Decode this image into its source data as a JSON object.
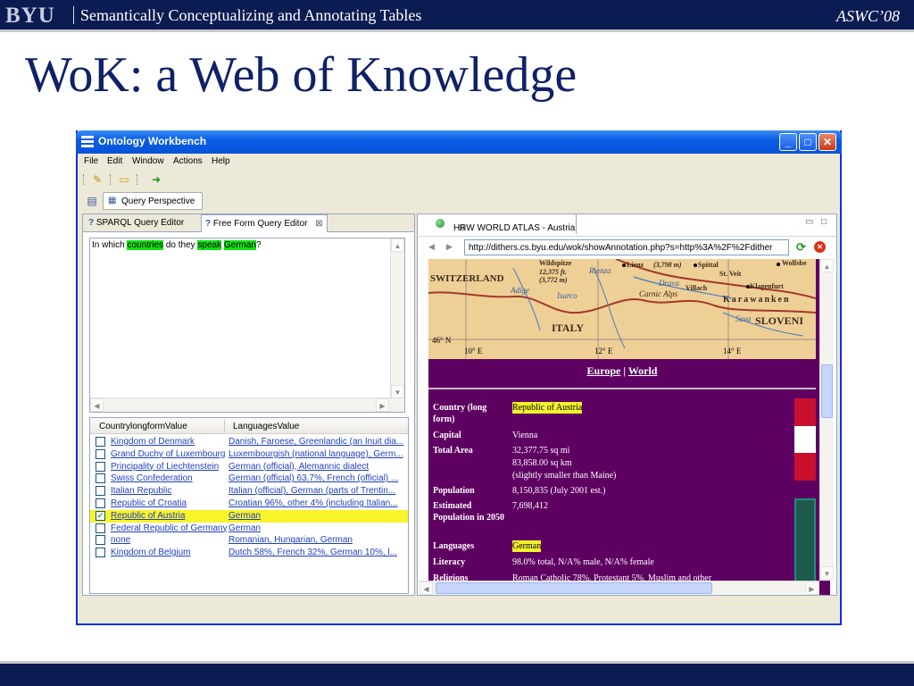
{
  "slide": {
    "logo": "BYU",
    "subtitle": "Semantically Conceptualizing and Annotating Tables",
    "conference": "ASWC’08",
    "title": "WoK: a Web of Knowledge"
  },
  "window": {
    "title": "Ontology Workbench",
    "menus": [
      "File",
      "Edit",
      "Window",
      "Actions",
      "Help"
    ],
    "perspective": "Query Perspective"
  },
  "left": {
    "tabs": [
      "SPARQL Query Editor",
      "Free Form Query Editor"
    ],
    "query": {
      "p1": "In which ",
      "w1": "countries",
      "p2": " do they ",
      "w2": "speak",
      "p3": " ",
      "w3": "German",
      "p4": "?"
    },
    "table": {
      "headers": [
        "CountrylongformValue",
        "LanguagesValue"
      ],
      "rows": [
        {
          "country": "Kingdom of Denmark",
          "language": "Danish, Faroese, Greenlandic (an Inuit dia...",
          "checked": false
        },
        {
          "country": "Grand Duchy of Luxembourg",
          "language": "Luxembourgish (national language), Germ...",
          "checked": false
        },
        {
          "country": "Principality of Liechtenstein",
          "language": "German (official), Alemannic dialect",
          "checked": false
        },
        {
          "country": "Swiss Confederation",
          "language": "German (official) 63.7%, French (official) ...",
          "checked": false
        },
        {
          "country": "Italian Republic",
          "language": "Italian (official), German (parts of Trentin...",
          "checked": false
        },
        {
          "country": "Republic of Croatia",
          "language": "Croatian 96%, other 4% (including Italian...",
          "checked": false
        },
        {
          "country": "Republic of Austria",
          "language": "German",
          "checked": true
        },
        {
          "country": "Federal Republic of Germany",
          "language": "German",
          "checked": false
        },
        {
          "country": "none",
          "language": "Romanian, Hungarian, German",
          "checked": false
        },
        {
          "country": "Kingdom of Belgium",
          "language": "Dutch 58%, French 32%, German 10%, l...",
          "checked": false
        }
      ]
    }
  },
  "right": {
    "tab": "HRW WORLD ATLAS - Austria",
    "url": "http://dithers.cs.byu.edu/wok/showAnnotation.php?s=http%3A%2F%2Fdither",
    "map": {
      "switzerland": "SWITZERLAND",
      "italy": "ITALY",
      "slovenia": "SLOVENI",
      "wildspitze": "Wildspitze",
      "wildspitze_ft": "12,375 ft.",
      "wildspitze_m": "(3,772 m)",
      "peak_m": "(3,798 m)",
      "lienz": "Lienz",
      "spittal": "Spittal",
      "stveit": "St. Veit",
      "wolfsberg": "Wolfsbe",
      "villach": "Villach",
      "klagenfurt": "Klagenfurt",
      "karawanken": "Karawanken",
      "rienza": "Rienza",
      "isarco": "Isarco",
      "adige": "Adige",
      "drava": "Drava",
      "carnic_alps": "Carnic Alps",
      "sava": "Sava",
      "lat": "46° N",
      "lon1": "10° E",
      "lon2": "12° E",
      "lon3": "14° E"
    },
    "links": [
      "Europe",
      "World"
    ],
    "link_sep": "|",
    "info": {
      "country_label": "Country (long form)",
      "country_value": "Republic of Austria",
      "capital_label": "Capital",
      "capital_value": "Vienna",
      "area_label": "Total Area",
      "area_value1": "32,377.75 sq mi",
      "area_value2": "83,858.00 sq km",
      "area_value3": "(slightly smaller than Maine)",
      "population_label": "Population",
      "population_value": "8,150,835 (July 2001 est.)",
      "estimated_label": "Estimated Population in 2050",
      "estimated_value": "7,698,412",
      "languages_label": "Languages",
      "languages_value": "German",
      "literacy_label": "Literacy",
      "literacy_value": "98.0% total, N/A% male, N/A% female",
      "religions_label": "Religions",
      "religions_value": "Roman Catholic 78%, Protestant 5%, Muslim and other"
    }
  },
  "icons": [
    "app-icon",
    "minimize-icon",
    "maximize-icon",
    "close-icon",
    "folder-open-icon",
    "run-icon",
    "perspective-icon",
    "globe-icon",
    "back-icon",
    "forward-icon",
    "refresh-icon",
    "stop-icon"
  ],
  "colors": {
    "slide_navy": "#0b1c52",
    "title_blue": "#0f2167",
    "query_highlight": "#13e013",
    "selection_yellow": "#f8f42a",
    "page_purple": "#5e0062",
    "austria_red": "#c8102e"
  }
}
